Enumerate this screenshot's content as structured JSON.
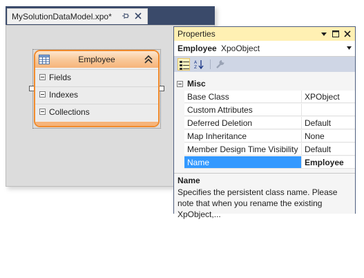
{
  "document": {
    "tab_title": "MySolutionDataModel.xpo*",
    "pin_icon": "pin-icon",
    "close_icon": "close-icon"
  },
  "entity": {
    "icon": "table-icon",
    "title": "Employee",
    "collapse_icon": "double-chevron-up-icon",
    "sections": [
      {
        "label": "Fields"
      },
      {
        "label": "Indexes"
      },
      {
        "label": "Collections"
      }
    ],
    "accent_color": "#f08a2c"
  },
  "properties": {
    "title": "Properties",
    "title_bar_color": "#fff0b3",
    "object_name": "Employee",
    "object_type": "XpoObject",
    "toolbar": [
      "categorized-icon",
      "alphabetical-icon",
      "property-pages-icon"
    ],
    "category": "Misc",
    "rows": [
      {
        "name": "Base Class",
        "value": "XPObject"
      },
      {
        "name": "Custom Attributes",
        "value": ""
      },
      {
        "name": "Deferred Deletion",
        "value": "Default"
      },
      {
        "name": "Map Inheritance",
        "value": "None"
      },
      {
        "name": "Member Design Time Visibility",
        "value": "Default"
      },
      {
        "name": "Name",
        "value": "Employee",
        "selected": true
      }
    ],
    "selection_color": "#3399ff",
    "description_title": "Name",
    "description_text": "Specifies the persistent class name. Please note that when you rename the existing XpObject,..."
  }
}
